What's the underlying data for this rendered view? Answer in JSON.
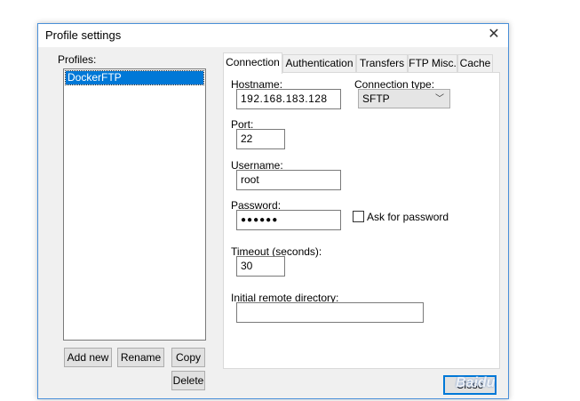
{
  "dialog": {
    "title": "Profile settings"
  },
  "profiles": {
    "label": "Profiles:",
    "items": [
      "DockerFTP"
    ],
    "buttons": {
      "add_new": "Add new",
      "rename": "Rename",
      "copy": "Copy",
      "delete": "Delete"
    }
  },
  "tabs": [
    "Connection",
    "Authentication",
    "Transfers",
    "FTP Misc.",
    "Cache"
  ],
  "active_tab": "Connection",
  "connection": {
    "hostname_label": "Hostname:",
    "hostname": "192.168.183.128",
    "connection_type_label": "Connection type:",
    "connection_type": "SFTP",
    "port_label": "Port:",
    "port": "22",
    "username_label": "Username:",
    "username": "root",
    "password_label": "Password:",
    "password_masked": "●●●●●●",
    "ask_for_password_label": "Ask for password",
    "ask_for_password_checked": false,
    "timeout_label": "Timeout (seconds):",
    "timeout": "30",
    "initial_dir_label": "Initial remote directory:",
    "initial_dir": ""
  },
  "footer": {
    "close_label": "Close"
  },
  "icons": {
    "close": "close-icon",
    "dropdown": "chevron-down-icon"
  },
  "colors": {
    "selection": "#0078d7",
    "dialog_border": "#4a90d9"
  }
}
